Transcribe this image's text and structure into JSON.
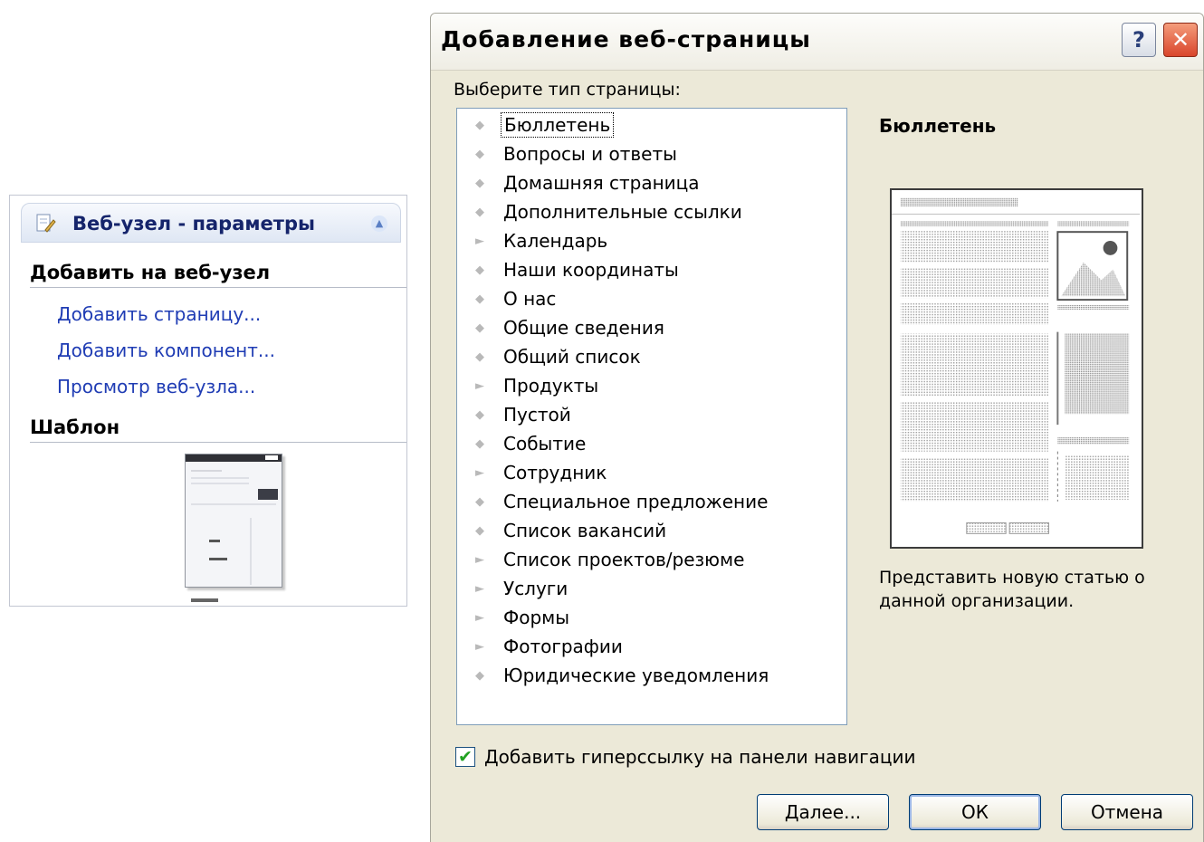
{
  "task_pane": {
    "title": "Веб-узел - параметры",
    "header_icon": "document-edit-icon",
    "collapse_icon": "chevron-up-icon",
    "section_add": "Добавить на веб-узел",
    "links": [
      "Добавить страницу...",
      "Добавить компонент...",
      "Просмотр веб-узла..."
    ],
    "section_template": "Шаблон"
  },
  "dialog": {
    "title": "Добавление веб-страницы",
    "help_label": "?",
    "close_label": "✕",
    "choose_label": "Выберите тип страницы:",
    "page_types": [
      {
        "label": "Бюллетень",
        "bullet": "dot",
        "selected": true
      },
      {
        "label": "Вопросы и ответы",
        "bullet": "dot"
      },
      {
        "label": "Домашняя страница",
        "bullet": "dot"
      },
      {
        "label": "Дополнительные ссылки",
        "bullet": "dot"
      },
      {
        "label": "Календарь",
        "bullet": "arrow"
      },
      {
        "label": "Наши координаты",
        "bullet": "dot"
      },
      {
        "label": "О нас",
        "bullet": "dot"
      },
      {
        "label": "Общие сведения",
        "bullet": "dot"
      },
      {
        "label": "Общий список",
        "bullet": "dot"
      },
      {
        "label": "Продукты",
        "bullet": "arrow"
      },
      {
        "label": "Пустой",
        "bullet": "dot"
      },
      {
        "label": "Событие",
        "bullet": "dot"
      },
      {
        "label": "Сотрудник",
        "bullet": "arrow"
      },
      {
        "label": "Специальное предложение",
        "bullet": "dot"
      },
      {
        "label": "Список вакансий",
        "bullet": "dot"
      },
      {
        "label": "Список проектов/резюме",
        "bullet": "arrow"
      },
      {
        "label": "Услуги",
        "bullet": "arrow"
      },
      {
        "label": "Формы",
        "bullet": "arrow"
      },
      {
        "label": "Фотографии",
        "bullet": "arrow"
      },
      {
        "label": "Юридические уведомления",
        "bullet": "dot"
      }
    ],
    "preview_title": "Бюллетень",
    "preview_description": "Представить новую статью о данной организации.",
    "checkbox_checked": true,
    "checkbox_label": "Добавить гиперссылку на панели навигации",
    "buttons": {
      "next": "Далее...",
      "ok": "ОК",
      "cancel": "Отмена"
    }
  },
  "colors": {
    "link": "#1f3cb4",
    "dialog_bg": "#ece9d8",
    "checkmark": "#21a121"
  }
}
